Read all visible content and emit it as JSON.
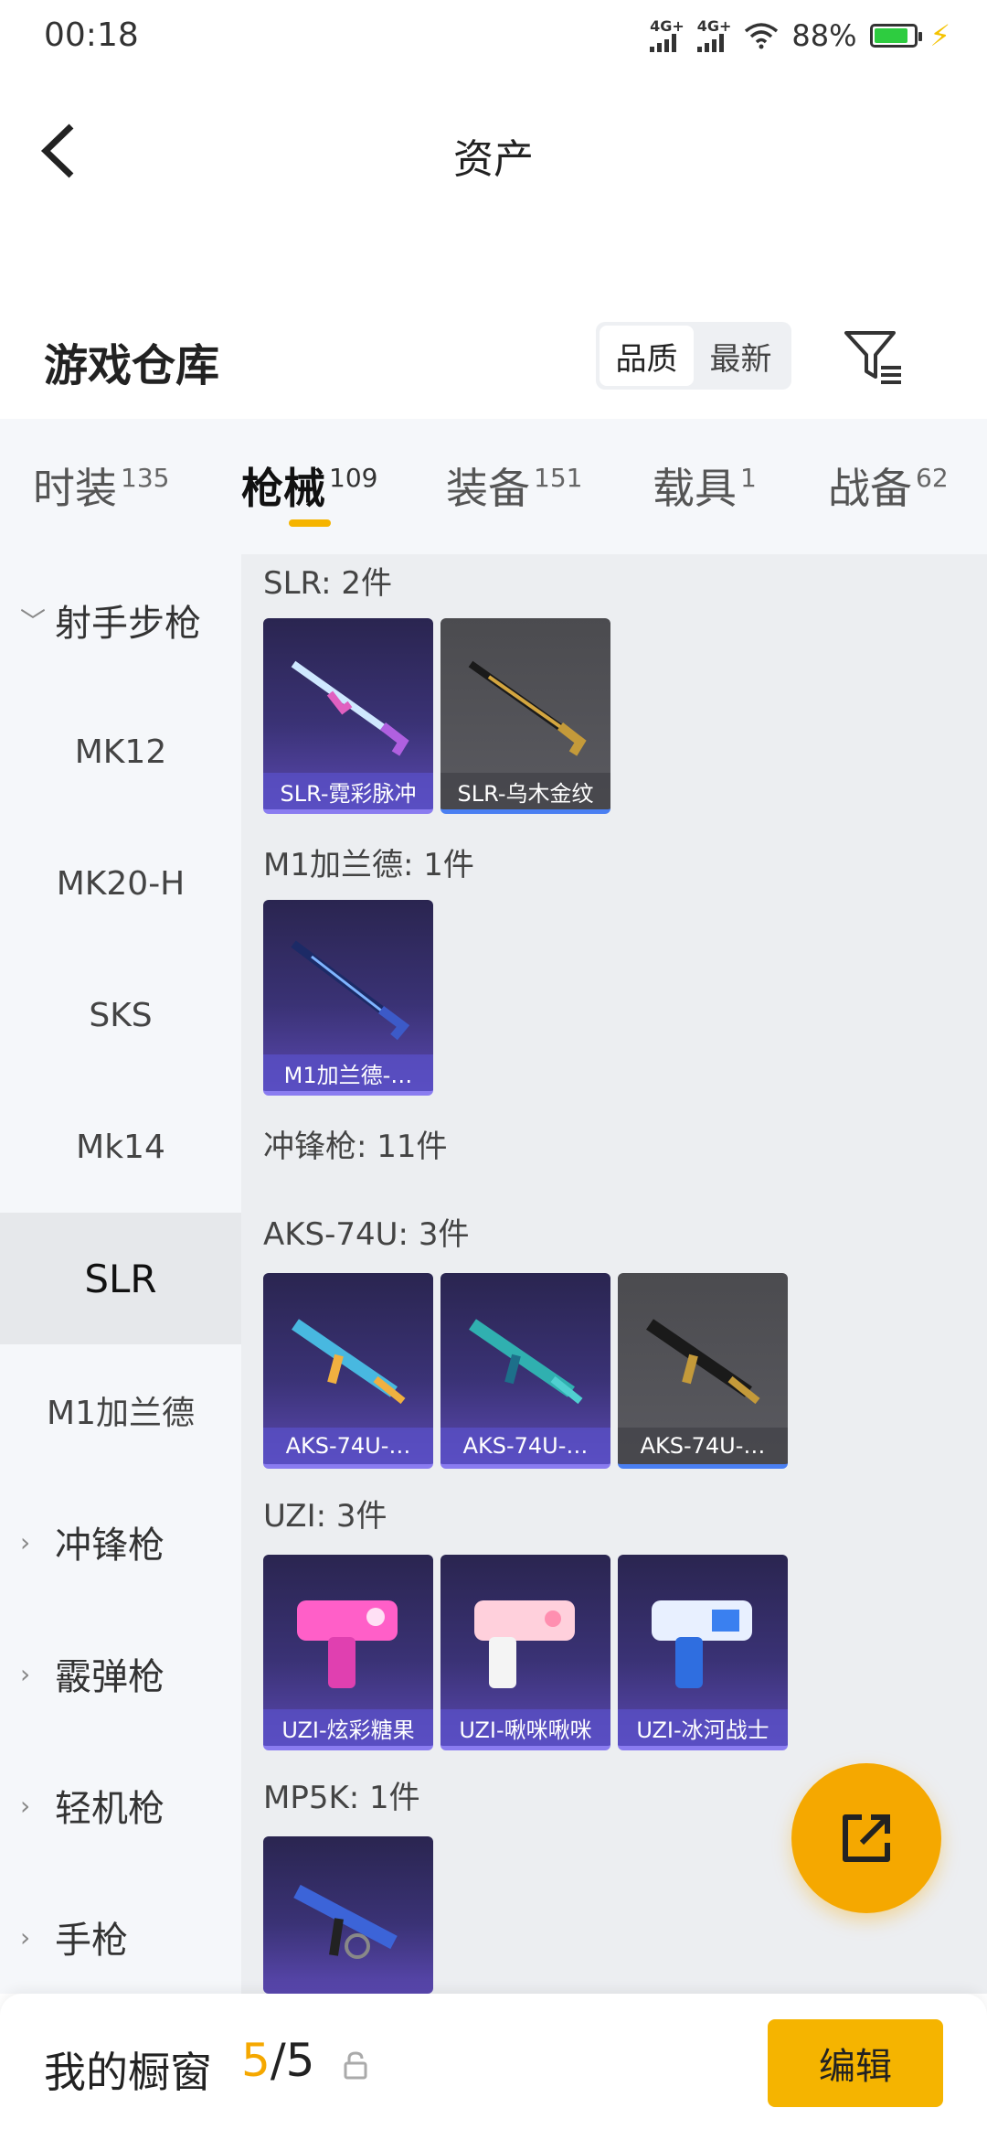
{
  "status_bar": {
    "time": "00:18",
    "signal1": "4G+",
    "signal2": "4G+",
    "battery": "88%"
  },
  "nav": {
    "title": "资产"
  },
  "warehouse": {
    "title": "游戏仓库",
    "sort_options": [
      "品质",
      "最新"
    ],
    "sort_selected": "品质"
  },
  "tabs": [
    {
      "label": "时装",
      "count": "135"
    },
    {
      "label": "枪械",
      "count": "109"
    },
    {
      "label": "装备",
      "count": "151"
    },
    {
      "label": "载具",
      "count": "1"
    },
    {
      "label": "战备",
      "count": "62"
    }
  ],
  "active_tab": "枪械",
  "sidebar": {
    "items": [
      {
        "label": "射手步枪",
        "type": "group",
        "expanded": true
      },
      {
        "label": "MK12",
        "type": "item"
      },
      {
        "label": "MK20-H",
        "type": "item"
      },
      {
        "label": "SKS",
        "type": "item"
      },
      {
        "label": "Mk14",
        "type": "item"
      },
      {
        "label": "SLR",
        "type": "item",
        "selected": true
      },
      {
        "label": "M1加兰德",
        "type": "item"
      },
      {
        "label": "冲锋枪",
        "type": "group"
      },
      {
        "label": "霰弹枪",
        "type": "group"
      },
      {
        "label": "轻机枪",
        "type": "group"
      },
      {
        "label": "手枪",
        "type": "group"
      }
    ]
  },
  "content": {
    "sections": [
      {
        "label": "SLR: 2件",
        "cards": [
          {
            "name": "SLR-霓彩脉冲",
            "style": "purple"
          },
          {
            "name": "SLR-乌木金纹",
            "style": "gray"
          }
        ]
      },
      {
        "label": "M1加兰德: 1件",
        "cards": [
          {
            "name": "M1加兰德-…",
            "style": "purple"
          }
        ]
      },
      {
        "label": "冲锋枪: 11件",
        "cards": []
      },
      {
        "label": "AKS-74U: 3件",
        "cards": [
          {
            "name": "AKS-74U-…",
            "style": "purple"
          },
          {
            "name": "AKS-74U-…",
            "style": "purple"
          },
          {
            "name": "AKS-74U-…",
            "style": "gray"
          }
        ]
      },
      {
        "label": "UZI: 3件",
        "cards": [
          {
            "name": "UZI-炫彩糖果",
            "style": "purple"
          },
          {
            "name": "UZI-啾咪啾咪",
            "style": "purple"
          },
          {
            "name": "UZI-冰河战士",
            "style": "purple"
          }
        ]
      },
      {
        "label": "MP5K: 1件",
        "cards": [
          {
            "name": "",
            "style": "purple"
          }
        ]
      }
    ]
  },
  "bottom_bar": {
    "title": "我的橱窗",
    "count_current": "5",
    "count_sep": "/",
    "count_total": "5",
    "edit_label": "编辑"
  },
  "colors": {
    "accent": "#f5b400",
    "card_purple": "#3a3275",
    "card_gray": "#55555a"
  }
}
